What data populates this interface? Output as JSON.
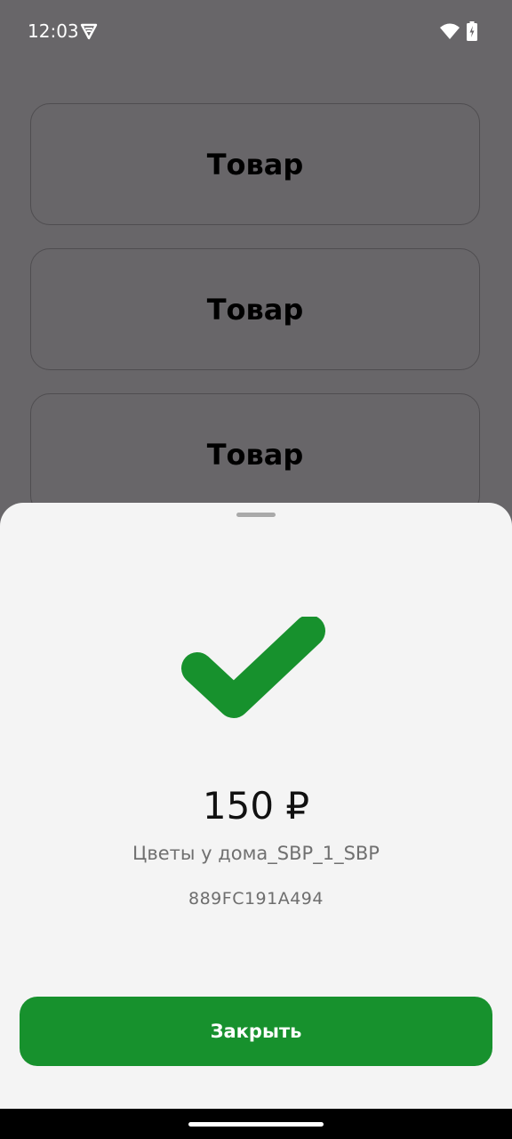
{
  "status_bar": {
    "time": "12:03",
    "icons": [
      "vpn-shield-icon",
      "wifi-icon",
      "battery-charging-icon"
    ]
  },
  "product_list": {
    "items": [
      {
        "label": "Товар"
      },
      {
        "label": "Товар"
      },
      {
        "label": "Товар"
      }
    ]
  },
  "payment_sheet": {
    "status_icon": "checkmark-icon",
    "amount": "150 ₽",
    "merchant": "Цветы у дома_SBP_1_SBP",
    "transaction_id": "889FC191A494",
    "close_label": "Закрыть"
  },
  "colors": {
    "accent_green": "#17912d",
    "sheet_background": "#f4f4f4",
    "scrim_background": "#686669"
  }
}
